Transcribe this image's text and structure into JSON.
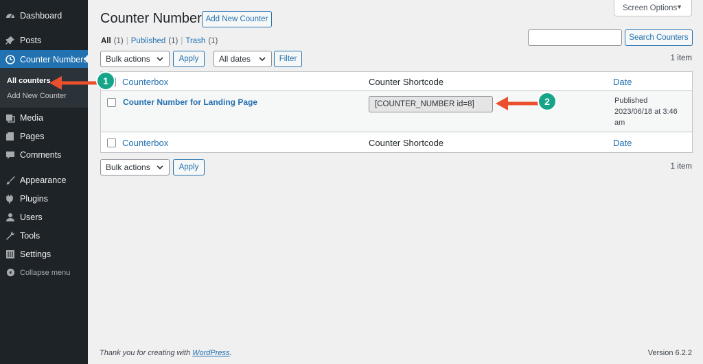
{
  "sidebar": {
    "items": [
      {
        "label": "Dashboard"
      },
      {
        "label": "Posts"
      },
      {
        "label": "Counter Numbers"
      },
      {
        "label": "Media"
      },
      {
        "label": "Pages"
      },
      {
        "label": "Comments"
      },
      {
        "label": "Appearance"
      },
      {
        "label": "Plugins"
      },
      {
        "label": "Users"
      },
      {
        "label": "Tools"
      },
      {
        "label": "Settings"
      }
    ],
    "submenu": [
      "All counters",
      "Add New Counter"
    ],
    "collapse": "Collapse menu"
  },
  "header": {
    "title": "Counter Numbers",
    "add_new": "Add New Counter",
    "screen_options": "Screen Options"
  },
  "filters": {
    "all": "All",
    "all_count": "(1)",
    "published": "Published",
    "published_count": "(1)",
    "trash": "Trash",
    "trash_count": "(1)",
    "sep": "|"
  },
  "search": {
    "value": "",
    "button": "Search Counters"
  },
  "toolbar": {
    "bulk_actions": "Bulk actions",
    "apply": "Apply",
    "all_dates": "All dates",
    "filter": "Filter",
    "count": "1 item"
  },
  "table": {
    "headers": [
      "Counterbox",
      "Counter Shortcode",
      "Date"
    ],
    "rows": [
      {
        "title": "Counter Number for Landing Page",
        "shortcode": "[COUNTER_NUMBER id=8]",
        "date_status": "Published",
        "date_line1": "2023/06/18 at 3:46",
        "date_line2": "am"
      }
    ]
  },
  "annotations": {
    "badge1": "1",
    "badge2": "2",
    "color": "#17a589",
    "arrow_color": "#ea4f2e"
  },
  "footer": {
    "thanks_prefix": "Thank you for creating with ",
    "wordpress": "WordPress",
    "thanks_suffix": ".",
    "version": "Version 6.2.2"
  }
}
